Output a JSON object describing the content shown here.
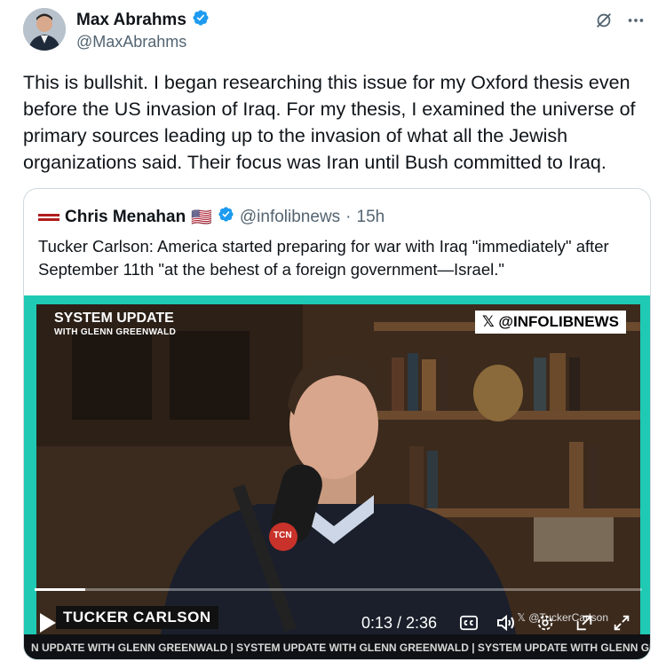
{
  "author": {
    "name": "Max Abrahms",
    "handle": "@MaxAbrahms",
    "verified_color": "#1d9bf0"
  },
  "tweet": {
    "text": "This is bullshit. I began researching this issue for my Oxford thesis even\nbefore the US invasion of Iraq. For my thesis, I examined the universe of\nprimary sources leading up to the invasion of what all the Jewish\norganizations said. Their focus was Iran until Bush committed to Iraq."
  },
  "quoted": {
    "name": "Chris Menahan",
    "flag": "🇺🇸",
    "handle": "@infolibnews",
    "separator": "·",
    "time": "15h",
    "text": "Tucker Carlson: America started preparing for war with Iraq \"immediately\" after\nSeptember 11th \"at the behest of a foreign government—Israel.\""
  },
  "video": {
    "show_title": "SYSTEM UPDATE",
    "show_subtitle": "WITH GLENN GREENWALD",
    "watermark": "@INFOLIBNEWS",
    "lower_third": "TUCKER CARLSON",
    "credit": "@TuckerCarlson",
    "ticker": "N UPDATE WITH GLENN GREENWALD   |   SYSTEM UPDATE WITH GLENN GREENWALD   |   SYSTEM UPDATE WITH GLENN GREENWALD",
    "mic_label": "TCN",
    "time_display": "0:13 / 2:36",
    "progress_fraction": 0.083,
    "accent": "#1fc9b3"
  },
  "icons": [
    "grok-icon",
    "more-icon",
    "verified-icon",
    "play-icon",
    "captions-icon",
    "volume-icon",
    "settings-icon",
    "pip-icon",
    "fullscreen-icon"
  ]
}
